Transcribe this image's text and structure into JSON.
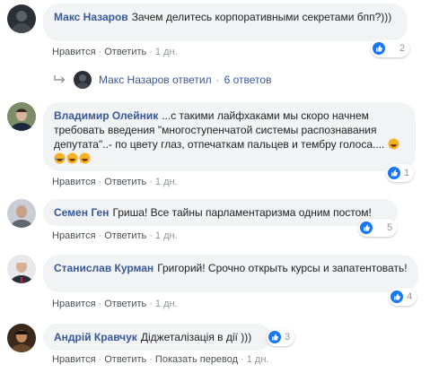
{
  "comments": [
    {
      "author": "Макс Назаров",
      "text": "Зачем делитесь корпоративными секретами бпп?)))",
      "actions": {
        "like": "Нравится",
        "reply": "Ответить",
        "time": "1 дн."
      },
      "reactions": {
        "count": "2",
        "icons": [
          "like-icon",
          "haha-icon"
        ]
      }
    },
    {
      "author": "Владимир Олейник",
      "text": "...с такими лайфхаками мы скоро начнем требовать введения \"многоступенчатой системы распознавания депутата\"..- по цвету глаз, отпечаткам пальцев и тембру голоса....",
      "actions": {
        "like": "Нравится",
        "reply": "Ответить",
        "time": "1 дн."
      },
      "reactions": {
        "count": "1",
        "icons": [
          "like-icon"
        ]
      }
    },
    {
      "author": "Семен Ген",
      "text": "Гриша! Все тайны парламентаризма одним постом!",
      "actions": {
        "like": "Нравится",
        "reply": "Ответить",
        "time": "1 дн."
      },
      "reactions": {
        "count": "5",
        "icons": [
          "like-icon",
          "haha-icon"
        ]
      }
    },
    {
      "author": "Станислав Курман",
      "text": "Григорий! Срочно открыть курсы и запатентовать!",
      "actions": {
        "like": "Нравится",
        "reply": "Ответить",
        "time": "1 дн."
      },
      "reactions": {
        "count": "4",
        "icons": [
          "like-icon"
        ]
      }
    },
    {
      "author": "Андрій Кравчук",
      "text": "Діджеталізація в дії )))",
      "actions": {
        "like": "Нравится",
        "reply": "Ответить",
        "translate": "Показать перевод",
        "time": "1 дн."
      },
      "reactions": {
        "count": "3",
        "icons": [
          "like-icon"
        ]
      }
    }
  ],
  "reply_summary": {
    "author": "Макс Назаров",
    "verb": "ответил",
    "count": "6 ответов"
  },
  "colors": {
    "author": "#385898",
    "bubble": "#f2f3f5",
    "meta": "#90949c",
    "like": "#1877f2",
    "haha": "#f7b125"
  }
}
